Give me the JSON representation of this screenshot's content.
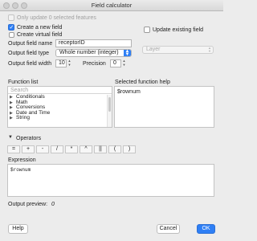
{
  "window": {
    "title": "Field calculator"
  },
  "top": {
    "only_selected_label": "Only update 0 selected features",
    "create_new_label": "Create a new field",
    "create_virtual_label": "Create virtual field",
    "output_name_label": "Output field name",
    "output_name_value": "receptorID",
    "output_type_label": "Output field type",
    "output_type_value": "Whole number (integer)",
    "output_width_label": "Output field width",
    "output_width_value": "10",
    "precision_label": "Precision",
    "precision_value": "0",
    "update_existing_label": "Update existing field",
    "layer_placeholder": "Layer"
  },
  "function_list": {
    "title": "Function list",
    "search_placeholder": "Search",
    "items": [
      "Conditionals",
      "Math",
      "Conversions",
      "Date and Time",
      "String"
    ]
  },
  "function_help": {
    "title": "Selected function help",
    "text": "$rownum"
  },
  "operators": {
    "title": "Operators",
    "buttons": [
      "=",
      "+",
      "-",
      "/",
      "*",
      "^",
      "||",
      "(",
      ")"
    ]
  },
  "expression": {
    "title": "Expression",
    "value": "$rownum"
  },
  "preview": {
    "label": "Output preview:",
    "value": "0"
  },
  "buttons": {
    "help": "Help",
    "cancel": "Cancel",
    "ok": "OK"
  }
}
